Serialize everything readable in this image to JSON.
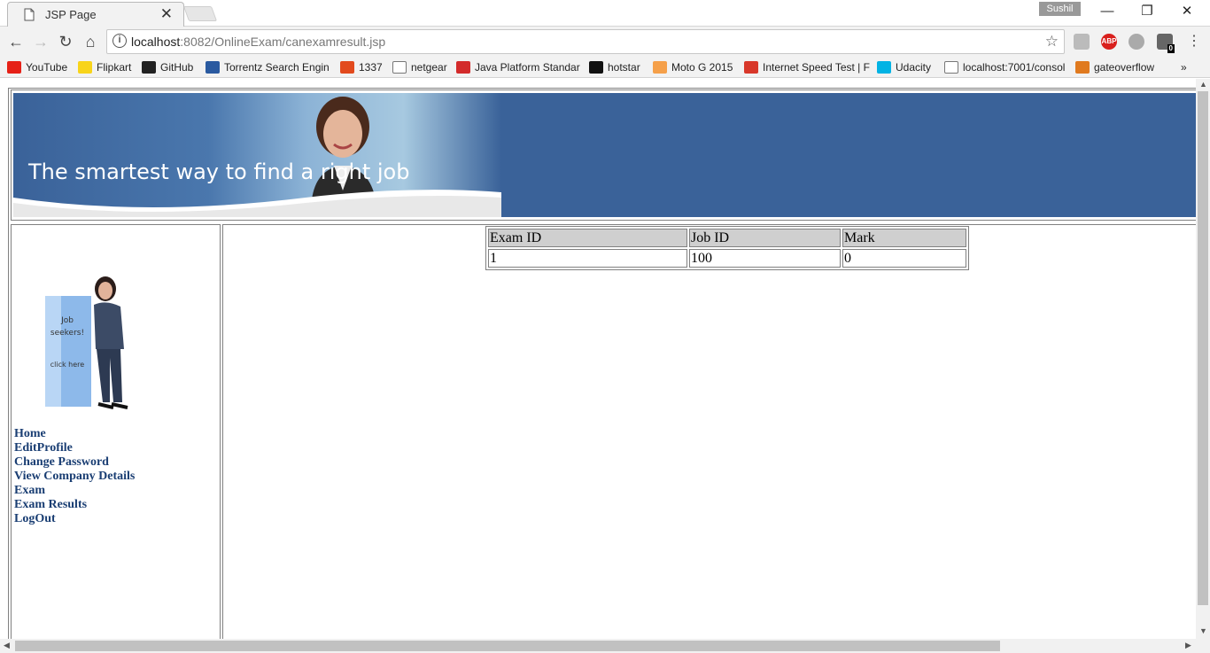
{
  "browser": {
    "tab_title": "JSP Page",
    "profile_name": "Sushil",
    "url_host": "localhost",
    "url_rest": ":8082/OnlineExam/canexamresult.jsp",
    "extension_badge": "0",
    "abp_label": "ABP"
  },
  "bookmarks": [
    {
      "label": "YouTube",
      "icon": "youtube-icon",
      "color": "#e62117"
    },
    {
      "label": "Flipkart",
      "icon": "flipkart-icon",
      "color": "#f8d41a"
    },
    {
      "label": "GitHub",
      "icon": "github-icon",
      "color": "#222222"
    },
    {
      "label": "Torrentz Search Engin",
      "icon": "torrentz-icon",
      "color": "#2a5aa0"
    },
    {
      "label": "1337",
      "icon": "1337x-icon",
      "color": "#e24a1d"
    },
    {
      "label": "netgear",
      "icon": "page-icon",
      "color": "#ffffff"
    },
    {
      "label": "Java Platform Standar",
      "icon": "oracle-icon",
      "color": "#d32b2b"
    },
    {
      "label": "hotstar",
      "icon": "hotstar-icon",
      "color": "#111111"
    },
    {
      "label": "Moto G 2015",
      "icon": "xda-icon",
      "color": "#f5a04a"
    },
    {
      "label": "Internet Speed Test | F",
      "icon": "speedtest-icon",
      "color": "#d8382a"
    },
    {
      "label": "Udacity",
      "icon": "udacity-icon",
      "color": "#02b3e4"
    },
    {
      "label": "localhost:7001/consol",
      "icon": "page-icon",
      "color": "#ffffff"
    },
    {
      "label": "gateoverflow",
      "icon": "gateoverflow-icon",
      "color": "#e07a1f"
    }
  ],
  "banner": {
    "tagline": "The smartest way to find a right job"
  },
  "sidebar": {
    "promo_text": "Job seekers! click here",
    "menu": [
      "Home",
      "EditProfile",
      "Change Password",
      "View Company Details",
      "Exam",
      "Exam Results",
      "LogOut"
    ]
  },
  "results": {
    "headers": [
      "Exam ID",
      "Job ID",
      "Mark"
    ],
    "rows": [
      [
        "1",
        "100",
        "0"
      ]
    ]
  }
}
